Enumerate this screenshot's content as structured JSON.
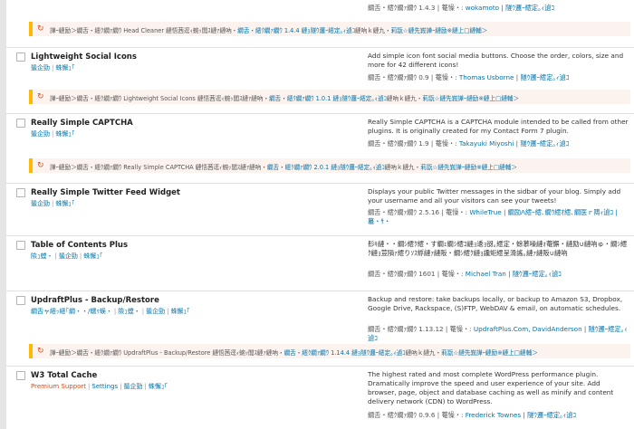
{
  "top": {
    "meta_prefix": "繝舌・繧ｸ繝ｧ繝ｳ 1.4.3 | 菴懆・: ",
    "author": "wokamoto",
    "sep": " | ",
    "details": "隧ｳ邏ｰ繧定｡ｨ遉ｺ"
  },
  "update_headcleaner": {
    "pre": "譁ｰ縺励＞繝舌・繧ｸ繝ｧ繝ｳ Head Cleaner 縺悟茜逕ｨ蜿ｯ閭ｽ縺ｧ縺吶・",
    "link": "繝舌・繧ｸ繝ｧ繝ｳ 1.4.4 縺ｮ隧ｳ邏ｰ繧定｡ｨ遉ｺ",
    "post": "縺吶ｋ縺九・",
    "link2": "莉翫☆縺先峩譁ｰ縺励※縺上□縺輔＞"
  },
  "plugins": [
    {
      "name": "Lightweight Social Icons",
      "actions": [
        "蜑企勁",
        "蛛懈ｭ｢"
      ],
      "desc": "Add simple icon font social media buttons. Choose the order, colors, size and more for 42 different icons!",
      "version": "繝舌・繧ｸ繝ｧ繝ｳ 0.9 | 菴懆・: ",
      "author": "Thomas Usborne",
      "details": "隧ｳ邏ｰ繧定｡ｨ遉ｺ",
      "update": {
        "pre": "譁ｰ縺励＞繝舌・繧ｸ繝ｧ繝ｳ Lightweight Social Icons 縺悟茜逕ｨ蜿ｯ閭ｽ縺ｧ縺吶・",
        "link": "繝舌・繧ｸ繝ｧ繝ｳ 1.0.1 縺ｮ隧ｳ邏ｰ繧定｡ｨ遉ｺ",
        "post": "縺吶ｋ縺九・",
        "link2": "莉翫☆縺先峩譁ｰ縺励※縺上□縺輔＞"
      }
    },
    {
      "name": "Really Simple CAPTCHA",
      "actions": [
        "蜑企勁",
        "蛛懈ｭ｢"
      ],
      "desc": "Really Simple CAPTCHA is a CAPTCHA module intended to be called from other plugins. It is originally created for my Contact Form 7 plugin.",
      "version": "繝舌・繧ｸ繝ｧ繝ｳ 1.9 | 菴懆・: ",
      "author": "Takayuki Miyoshi",
      "details": "隧ｳ邏ｰ繧定｡ｨ遉ｺ",
      "update": {
        "pre": "譁ｰ縺励＞繝舌・繧ｸ繝ｧ繝ｳ Really Simple CAPTCHA 縺悟茜逕ｨ蜿ｯ閭ｽ縺ｧ縺吶・",
        "link": "繝舌・繧ｸ繝ｧ繝ｳ 2.0.1 縺ｮ隧ｳ邏ｰ繧定｡ｨ遉ｺ",
        "post": "縺吶ｋ縺九・",
        "link2": "莉翫☆縺先峩譁ｰ縺励※縺上□縺輔＞"
      }
    },
    {
      "name": "Really Simple Twitter Feed Widget",
      "actions": [
        "蜑企勁",
        "蛛懈ｭ｢"
      ],
      "desc": "Displays your public Twitter messages in the sidbar of your blog. Simply add your username and all your visitors can see your tweets!",
      "version": "繝舌・繧ｸ繝ｧ繝ｳ 2.5.16 | 菴懆・: ",
      "author": "WhileTrue",
      "extra": "繝励Λ繧ｰ繧､繝ｳ繧ｵ繧､繝医ｒ陦ｨ遉ｺ | 蟇・ｻ・",
      "details": ""
    },
    {
      "name": "Table of Contents Plus",
      "actions": [
        "險ｭ螳・",
        "蜑企勁",
        "蛛懈ｭ｢"
      ],
      "desc": "髟ｷ縺・・繝ｼ繧ｸ繧・す繝ｪ繝ｼ繧ｺ縺ｮ逶ｮ谺｡繧定・蜍慕噪縺ｫ菴懈・縺励∪縺吶ゅ・繝ｼ繧ｸ縺ｮ荳隕ｧ繧りｿｽ蜉縺ｧ縺阪・繝ｼ繧ｸ縺ｮ讒矩繧呈滑謠｡縺ｧ縺阪∪縺吶",
      "version": "繝舌・繧ｸ繝ｧ繝ｳ 1601 | 菴懆・: ",
      "author": "Michael Tran",
      "details": "隧ｳ邏ｰ繧定｡ｨ遉ｺ"
    },
    {
      "name": "UpdraftPlus - Backup/Restore",
      "actions": [
        "繝舌ャ繧ｯ繧｢繝・・/蠕ｩ蜈・",
        "險ｭ螳・",
        "蜑企勁",
        "蛛懈ｭ｢"
      ],
      "desc": "Backup and restore: take backups locally, or backup to Amazon S3, Dropbox, Google Drive, Rackspace, (S)FTP, WebDAV & email, on automatic schedules.",
      "version": "繝舌・繧ｸ繝ｧ繝ｳ 1.13.12 | 菴懆・: ",
      "author": "UpdraftPlus.Com, DavidAnderson",
      "details": "隧ｳ邏ｰ繧定｡ｨ遉ｺ",
      "update": {
        "pre": "譁ｰ縺励＞繝舌・繧ｸ繝ｧ繝ｳ UpdraftPlus - Backup/Restore 縺悟茜逕ｨ蜿ｯ閭ｽ縺ｧ縺吶・",
        "link": "繝舌・繧ｸ繝ｧ繝ｳ 1.14.4 縺ｮ隧ｳ邏ｰ繧定｡ｨ遉ｺ",
        "post": "縺吶ｋ縺九・",
        "link2": "莉翫☆縺先峩譁ｰ縺励※縺上□縺輔＞"
      }
    },
    {
      "name": "W3 Total Cache",
      "actions": [
        "Premium Support",
        "Settings",
        "蜑企勁",
        "蛛懈ｭ｢"
      ],
      "desc": "The highest rated and most complete WordPress performance plugin. Dramatically improve the speed and user experience of your site. Add browser, page, object and database caching as well as minify and content delivery network (CDN) to WordPress.",
      "version": "繝舌・繧ｸ繝ｧ繝ｳ 0.9.6 | 菴懆・: ",
      "author": "Frederick Townes",
      "details": "隧ｳ邏ｰ繧定｡ｨ遉ｺ"
    }
  ],
  "colors": {
    "link": "#0073aa",
    "update_border": "#ffb900",
    "update_bg": "#fcf3ef",
    "warn": "#d54e21"
  }
}
